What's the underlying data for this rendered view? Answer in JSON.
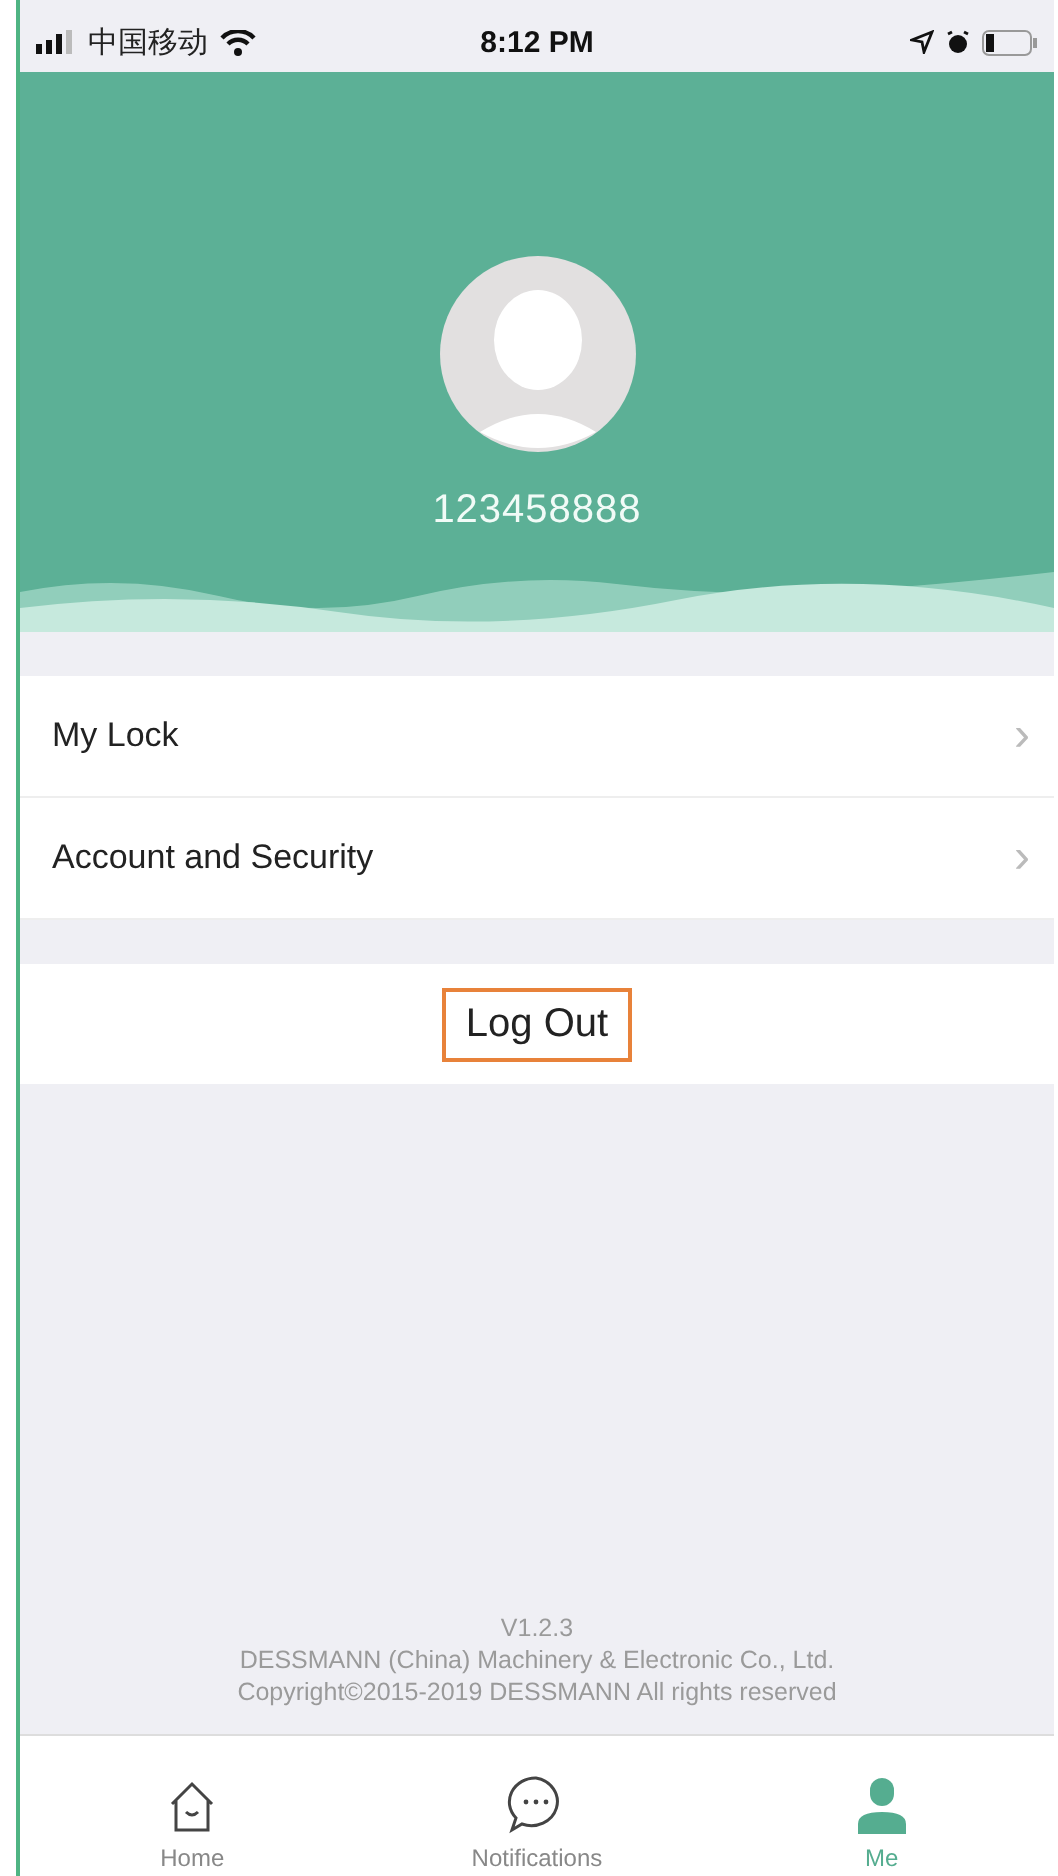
{
  "status_bar": {
    "carrier": "中国移动",
    "time": "8:12 PM"
  },
  "profile": {
    "username": "123458888"
  },
  "menu": [
    {
      "label": "My Lock",
      "chevron": "›"
    },
    {
      "label": "Account and Security",
      "chevron": "›"
    }
  ],
  "logout_button": {
    "label": "Log Out"
  },
  "footer": [
    "V1.2.3",
    "DESSMANN (China) Machinery & Electronic Co., Ltd.",
    "Copyright©2015-2019 DESSMANN All rights reserved"
  ],
  "tabs": [
    {
      "kind": "home",
      "label": "Home",
      "selected": false
    },
    {
      "kind": "notifications",
      "label": "Notifications",
      "selected": false
    },
    {
      "kind": "me",
      "label": "Me",
      "selected": true
    }
  ]
}
